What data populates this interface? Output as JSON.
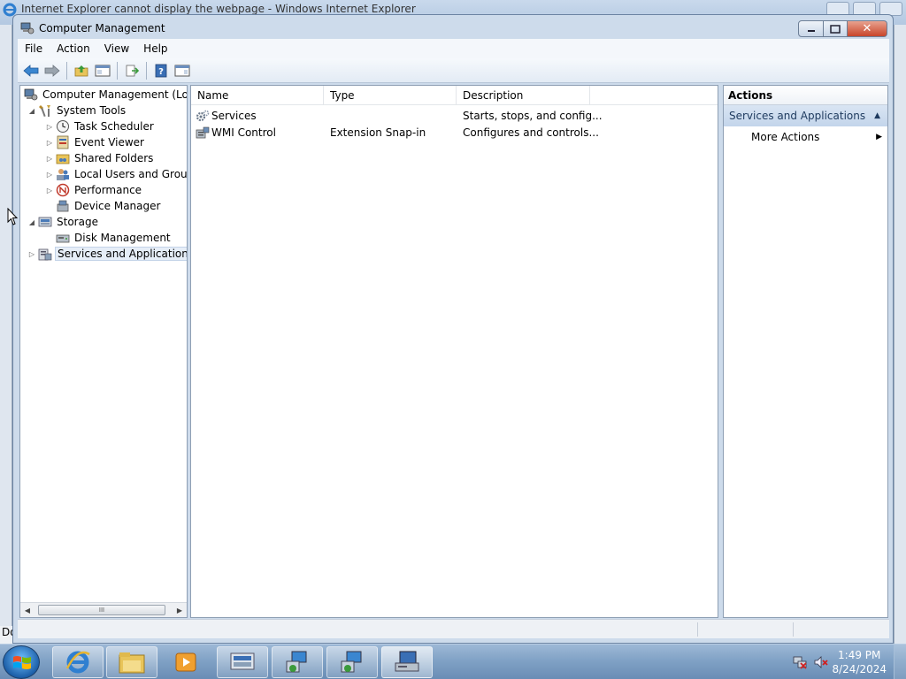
{
  "ie": {
    "title": "Internet Explorer cannot display the webpage - Windows Internet Explorer",
    "status_prefix": "Do"
  },
  "window": {
    "title": "Computer Management",
    "close_glyph": "✕"
  },
  "menu": [
    "File",
    "Action",
    "View",
    "Help"
  ],
  "toolbar": {
    "buttons": [
      "back-icon",
      "forward-icon",
      "up-folder-icon",
      "show-hide-tree-icon",
      "export-list-icon",
      "help-icon",
      "show-hide-action-pane-icon"
    ]
  },
  "tree": {
    "root": "Computer Management (Local",
    "system_tools": "System Tools",
    "task_scheduler": "Task Scheduler",
    "event_viewer": "Event Viewer",
    "shared_folders": "Shared Folders",
    "local_users": "Local Users and Groups",
    "performance": "Performance",
    "device_manager": "Device Manager",
    "storage": "Storage",
    "disk_management": "Disk Management",
    "services_apps": "Services and Applications",
    "scroll_grip": "III"
  },
  "list": {
    "columns": [
      "Name",
      "Type",
      "Description"
    ],
    "rows": [
      {
        "name": "Services",
        "type": "",
        "description": "Starts, stops, and config..."
      },
      {
        "name": "WMI Control",
        "type": "Extension Snap-in",
        "description": "Configures and controls..."
      }
    ]
  },
  "actions": {
    "header": "Actions",
    "section": "Services and Applications",
    "items": [
      "More Actions"
    ]
  },
  "taskbar": {
    "time": "1:49 PM",
    "date": "8/24/2024"
  },
  "colors": {
    "selection": "#e6eef8",
    "action_section": "#c3d5eb",
    "close_button": "#c8452a"
  }
}
